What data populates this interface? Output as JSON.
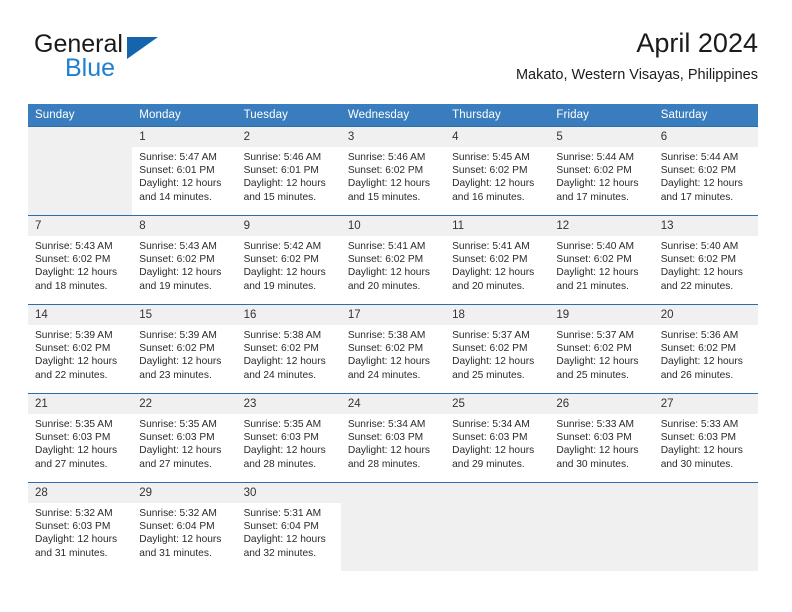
{
  "brand": {
    "name_part1": "General",
    "name_part2": "Blue",
    "triangle_color": "#1565ad",
    "blue_color": "#1f7fd0"
  },
  "header": {
    "title": "April 2024",
    "subtitle": "Makato, Western Visayas, Philippines"
  },
  "theme": {
    "header_row_bg": "#3a7dbf",
    "week_border": "#2f6ca8",
    "daynum_bg": "#f0f0f0"
  },
  "calendar": {
    "weekday_headers": [
      "Sunday",
      "Monday",
      "Tuesday",
      "Wednesday",
      "Thursday",
      "Friday",
      "Saturday"
    ],
    "weeks": [
      [
        {
          "day": "",
          "sunrise": "",
          "sunset": "",
          "daylight1": "",
          "daylight2": "",
          "empty": true
        },
        {
          "day": "1",
          "sunrise": "Sunrise: 5:47 AM",
          "sunset": "Sunset: 6:01 PM",
          "daylight1": "Daylight: 12 hours",
          "daylight2": "and 14 minutes.",
          "empty": false
        },
        {
          "day": "2",
          "sunrise": "Sunrise: 5:46 AM",
          "sunset": "Sunset: 6:01 PM",
          "daylight1": "Daylight: 12 hours",
          "daylight2": "and 15 minutes.",
          "empty": false
        },
        {
          "day": "3",
          "sunrise": "Sunrise: 5:46 AM",
          "sunset": "Sunset: 6:02 PM",
          "daylight1": "Daylight: 12 hours",
          "daylight2": "and 15 minutes.",
          "empty": false
        },
        {
          "day": "4",
          "sunrise": "Sunrise: 5:45 AM",
          "sunset": "Sunset: 6:02 PM",
          "daylight1": "Daylight: 12 hours",
          "daylight2": "and 16 minutes.",
          "empty": false
        },
        {
          "day": "5",
          "sunrise": "Sunrise: 5:44 AM",
          "sunset": "Sunset: 6:02 PM",
          "daylight1": "Daylight: 12 hours",
          "daylight2": "and 17 minutes.",
          "empty": false
        },
        {
          "day": "6",
          "sunrise": "Sunrise: 5:44 AM",
          "sunset": "Sunset: 6:02 PM",
          "daylight1": "Daylight: 12 hours",
          "daylight2": "and 17 minutes.",
          "empty": false
        }
      ],
      [
        {
          "day": "7",
          "sunrise": "Sunrise: 5:43 AM",
          "sunset": "Sunset: 6:02 PM",
          "daylight1": "Daylight: 12 hours",
          "daylight2": "and 18 minutes.",
          "empty": false
        },
        {
          "day": "8",
          "sunrise": "Sunrise: 5:43 AM",
          "sunset": "Sunset: 6:02 PM",
          "daylight1": "Daylight: 12 hours",
          "daylight2": "and 19 minutes.",
          "empty": false
        },
        {
          "day": "9",
          "sunrise": "Sunrise: 5:42 AM",
          "sunset": "Sunset: 6:02 PM",
          "daylight1": "Daylight: 12 hours",
          "daylight2": "and 19 minutes.",
          "empty": false
        },
        {
          "day": "10",
          "sunrise": "Sunrise: 5:41 AM",
          "sunset": "Sunset: 6:02 PM",
          "daylight1": "Daylight: 12 hours",
          "daylight2": "and 20 minutes.",
          "empty": false
        },
        {
          "day": "11",
          "sunrise": "Sunrise: 5:41 AM",
          "sunset": "Sunset: 6:02 PM",
          "daylight1": "Daylight: 12 hours",
          "daylight2": "and 20 minutes.",
          "empty": false
        },
        {
          "day": "12",
          "sunrise": "Sunrise: 5:40 AM",
          "sunset": "Sunset: 6:02 PM",
          "daylight1": "Daylight: 12 hours",
          "daylight2": "and 21 minutes.",
          "empty": false
        },
        {
          "day": "13",
          "sunrise": "Sunrise: 5:40 AM",
          "sunset": "Sunset: 6:02 PM",
          "daylight1": "Daylight: 12 hours",
          "daylight2": "and 22 minutes.",
          "empty": false
        }
      ],
      [
        {
          "day": "14",
          "sunrise": "Sunrise: 5:39 AM",
          "sunset": "Sunset: 6:02 PM",
          "daylight1": "Daylight: 12 hours",
          "daylight2": "and 22 minutes.",
          "empty": false
        },
        {
          "day": "15",
          "sunrise": "Sunrise: 5:39 AM",
          "sunset": "Sunset: 6:02 PM",
          "daylight1": "Daylight: 12 hours",
          "daylight2": "and 23 minutes.",
          "empty": false
        },
        {
          "day": "16",
          "sunrise": "Sunrise: 5:38 AM",
          "sunset": "Sunset: 6:02 PM",
          "daylight1": "Daylight: 12 hours",
          "daylight2": "and 24 minutes.",
          "empty": false
        },
        {
          "day": "17",
          "sunrise": "Sunrise: 5:38 AM",
          "sunset": "Sunset: 6:02 PM",
          "daylight1": "Daylight: 12 hours",
          "daylight2": "and 24 minutes.",
          "empty": false
        },
        {
          "day": "18",
          "sunrise": "Sunrise: 5:37 AM",
          "sunset": "Sunset: 6:02 PM",
          "daylight1": "Daylight: 12 hours",
          "daylight2": "and 25 minutes.",
          "empty": false
        },
        {
          "day": "19",
          "sunrise": "Sunrise: 5:37 AM",
          "sunset": "Sunset: 6:02 PM",
          "daylight1": "Daylight: 12 hours",
          "daylight2": "and 25 minutes.",
          "empty": false
        },
        {
          "day": "20",
          "sunrise": "Sunrise: 5:36 AM",
          "sunset": "Sunset: 6:02 PM",
          "daylight1": "Daylight: 12 hours",
          "daylight2": "and 26 minutes.",
          "empty": false
        }
      ],
      [
        {
          "day": "21",
          "sunrise": "Sunrise: 5:35 AM",
          "sunset": "Sunset: 6:03 PM",
          "daylight1": "Daylight: 12 hours",
          "daylight2": "and 27 minutes.",
          "empty": false
        },
        {
          "day": "22",
          "sunrise": "Sunrise: 5:35 AM",
          "sunset": "Sunset: 6:03 PM",
          "daylight1": "Daylight: 12 hours",
          "daylight2": "and 27 minutes.",
          "empty": false
        },
        {
          "day": "23",
          "sunrise": "Sunrise: 5:35 AM",
          "sunset": "Sunset: 6:03 PM",
          "daylight1": "Daylight: 12 hours",
          "daylight2": "and 28 minutes.",
          "empty": false
        },
        {
          "day": "24",
          "sunrise": "Sunrise: 5:34 AM",
          "sunset": "Sunset: 6:03 PM",
          "daylight1": "Daylight: 12 hours",
          "daylight2": "and 28 minutes.",
          "empty": false
        },
        {
          "day": "25",
          "sunrise": "Sunrise: 5:34 AM",
          "sunset": "Sunset: 6:03 PM",
          "daylight1": "Daylight: 12 hours",
          "daylight2": "and 29 minutes.",
          "empty": false
        },
        {
          "day": "26",
          "sunrise": "Sunrise: 5:33 AM",
          "sunset": "Sunset: 6:03 PM",
          "daylight1": "Daylight: 12 hours",
          "daylight2": "and 30 minutes.",
          "empty": false
        },
        {
          "day": "27",
          "sunrise": "Sunrise: 5:33 AM",
          "sunset": "Sunset: 6:03 PM",
          "daylight1": "Daylight: 12 hours",
          "daylight2": "and 30 minutes.",
          "empty": false
        }
      ],
      [
        {
          "day": "28",
          "sunrise": "Sunrise: 5:32 AM",
          "sunset": "Sunset: 6:03 PM",
          "daylight1": "Daylight: 12 hours",
          "daylight2": "and 31 minutes.",
          "empty": false
        },
        {
          "day": "29",
          "sunrise": "Sunrise: 5:32 AM",
          "sunset": "Sunset: 6:04 PM",
          "daylight1": "Daylight: 12 hours",
          "daylight2": "and 31 minutes.",
          "empty": false
        },
        {
          "day": "30",
          "sunrise": "Sunrise: 5:31 AM",
          "sunset": "Sunset: 6:04 PM",
          "daylight1": "Daylight: 12 hours",
          "daylight2": "and 32 minutes.",
          "empty": false
        },
        {
          "day": "",
          "sunrise": "",
          "sunset": "",
          "daylight1": "",
          "daylight2": "",
          "empty": true
        },
        {
          "day": "",
          "sunrise": "",
          "sunset": "",
          "daylight1": "",
          "daylight2": "",
          "empty": true
        },
        {
          "day": "",
          "sunrise": "",
          "sunset": "",
          "daylight1": "",
          "daylight2": "",
          "empty": true
        },
        {
          "day": "",
          "sunrise": "",
          "sunset": "",
          "daylight1": "",
          "daylight2": "",
          "empty": true
        }
      ]
    ]
  }
}
